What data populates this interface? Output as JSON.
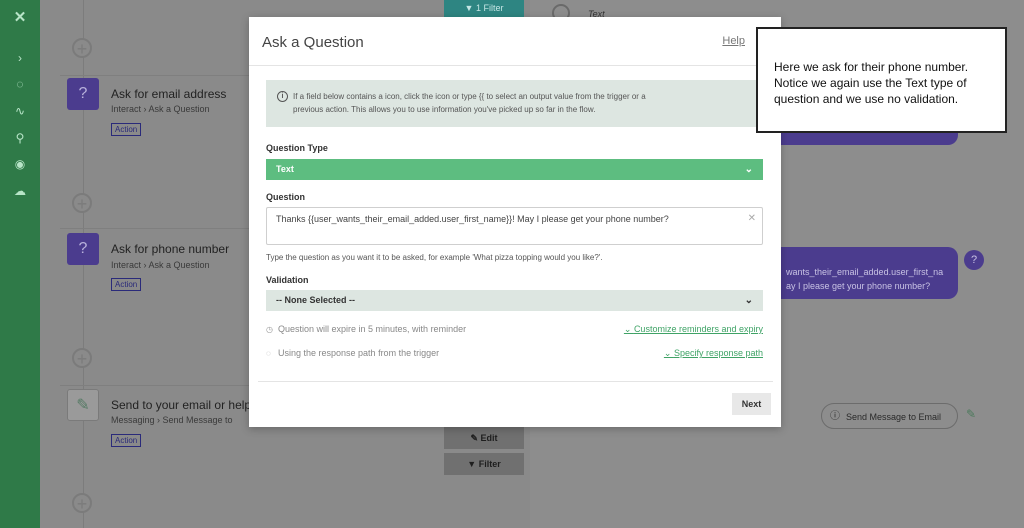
{
  "background": {
    "filter_top_label": "1 Filter",
    "text_label": "Text",
    "steps": [
      {
        "title": "Ask for email address",
        "sub": "Interact › Ask a Question",
        "badge": "Action"
      },
      {
        "title": "Ask for phone number",
        "sub": "Interact › Ask a Question",
        "badge": "Action"
      },
      {
        "title": "Send to your email or help",
        "sub": "Messaging › Send Message to",
        "badge": "Action"
      }
    ],
    "edit_label": "Edit",
    "filter_label": "Filter",
    "chat_line1": "wants_their_email_added.user_first_na",
    "chat_line2": "ay I please get your phone number?",
    "send_message_label": "Send Message to Email"
  },
  "modal": {
    "title": "Ask a Question",
    "help": "Help",
    "info_line1": "If a field below contains a  icon, click the icon or type {{ to select an output value from the trigger or a",
    "info_line2": "previous action. This allows you to use information you've picked up so far in the flow.",
    "question_type_label": "Question Type",
    "question_type_value": "Text",
    "question_label": "Question",
    "question_value": "Thanks {{user_wants_their_email_added.user_first_name}}! May I please get your phone number?",
    "question_hint": "Type the question as you want it to be asked, for example 'What pizza topping would you like?'.",
    "validation_label": "Validation",
    "validation_value": "-- None Selected --",
    "expire_text": "Question will expire in 5 minutes, with reminder",
    "customize_link": "Customize reminders and expiry",
    "response_text": "Using the response path from the trigger",
    "specify_link": "Specify response path",
    "next_label": "Next"
  },
  "callout": {
    "text": "Here we ask for their phone number. Notice we again use the Text type of question and we use no validation."
  }
}
